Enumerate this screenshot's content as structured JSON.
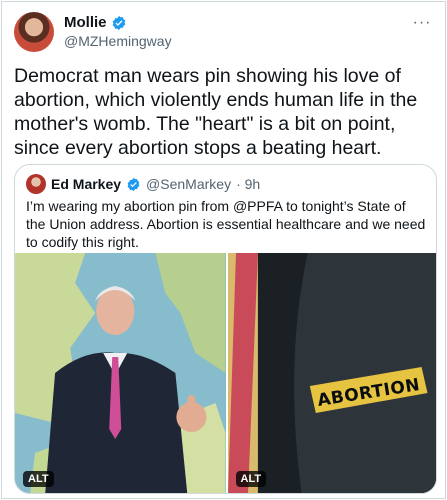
{
  "tweet": {
    "author_name": "Mollie",
    "author_handle": "@MZHemingway",
    "text": "Democrat man wears pin showing his love of abortion, which violently ends human life in the mother's womb. The \"heart\" is a bit on point, since every abortion stops a beating heart.",
    "more_label": "···"
  },
  "quote": {
    "author_name": "Ed Markey",
    "author_handle": "@SenMarkey",
    "time": "· 9h",
    "text": "I’m wearing my abortion pin from @PPFA to tonight’s State of the Union address. Abortion is essential healthcare and we need to codify this right.",
    "media": [
      {
        "alt_badge": "ALT"
      },
      {
        "alt_badge": "ALT",
        "pin_text": "ABORTION"
      }
    ]
  },
  "colors": {
    "verified": "#1d9bf0",
    "secondary_text": "#536471",
    "border": "#cfd9de",
    "pin_gold": "#e6c340"
  },
  "icons": [
    "verified-badge-icon",
    "more-options-icon"
  ]
}
